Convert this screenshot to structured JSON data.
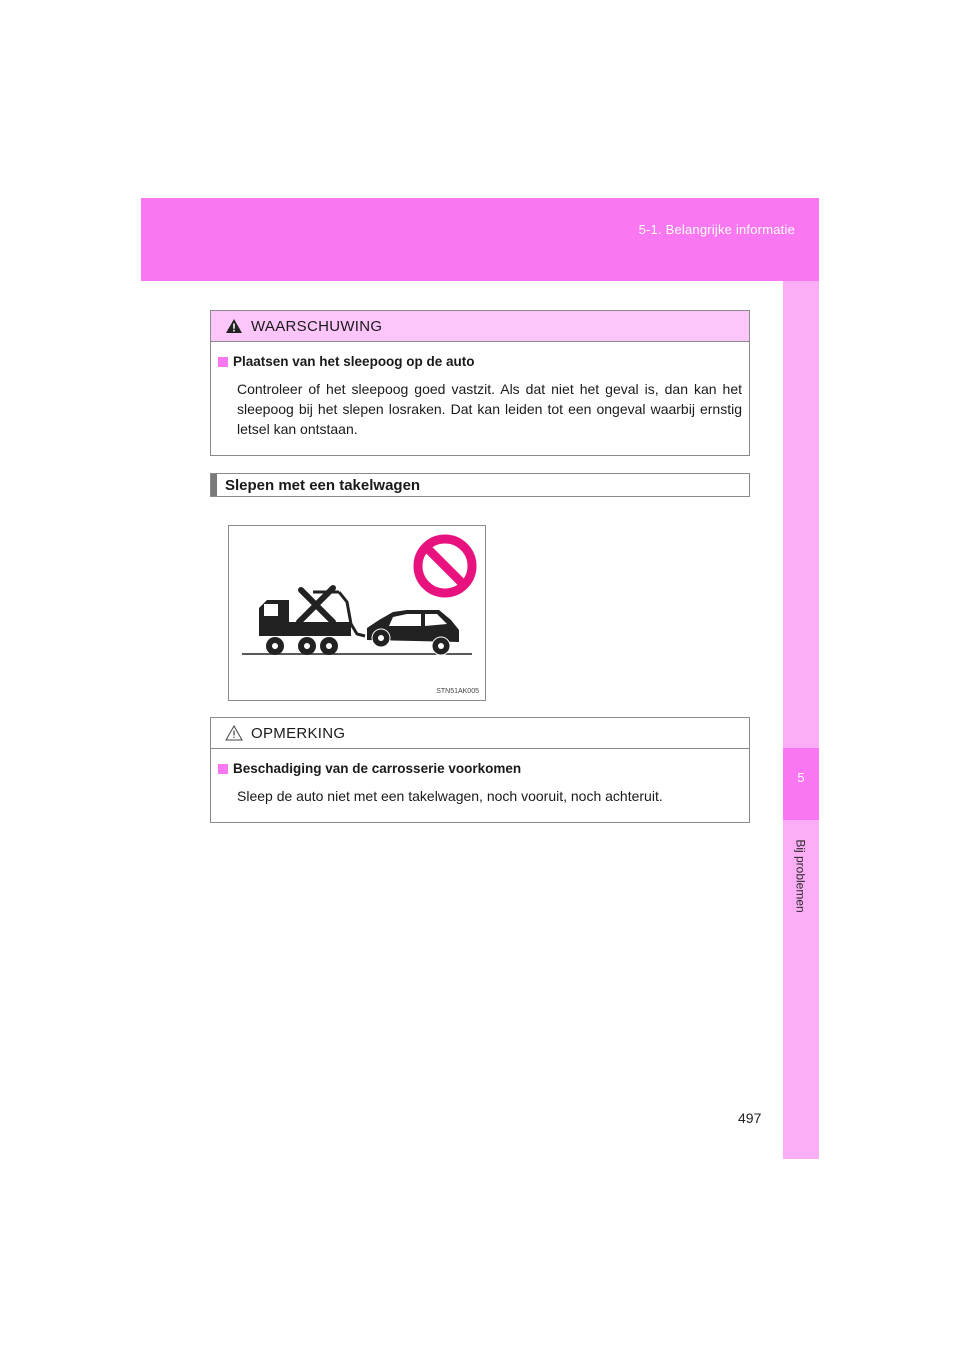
{
  "header": {
    "section": "5-1. Belangrijke informatie"
  },
  "side_tab": {
    "number": "5",
    "label": "Bij problemen"
  },
  "page_number": "497",
  "warning": {
    "title": "WAARSCHUWING",
    "subheading": "Plaatsen van het sleepoog op de auto",
    "text": "Controleer of het sleepoog goed vastzit. Als dat niet het geval is, dan kan het sleepoog bij het slepen losraken. Dat kan leiden tot een ongeval waarbij ernstig letsel kan ontstaan."
  },
  "section": {
    "title": "Slepen met een takelwagen"
  },
  "figure": {
    "code": "STN51AK005",
    "icons": [
      "tow-truck-icon",
      "car-icon",
      "prohibited-icon"
    ]
  },
  "notice": {
    "title": "OPMERKING",
    "subheading": "Beschadiging van de carrosserie voorkomen",
    "text": "Sleep de auto niet met een takelwagen, noch vooruit, noch achteruit."
  },
  "colors": {
    "accent": "#f977f0",
    "accent_light": "#fbaef6",
    "warning_header": "#fdc6fa",
    "prohibited": "#e8127f"
  }
}
